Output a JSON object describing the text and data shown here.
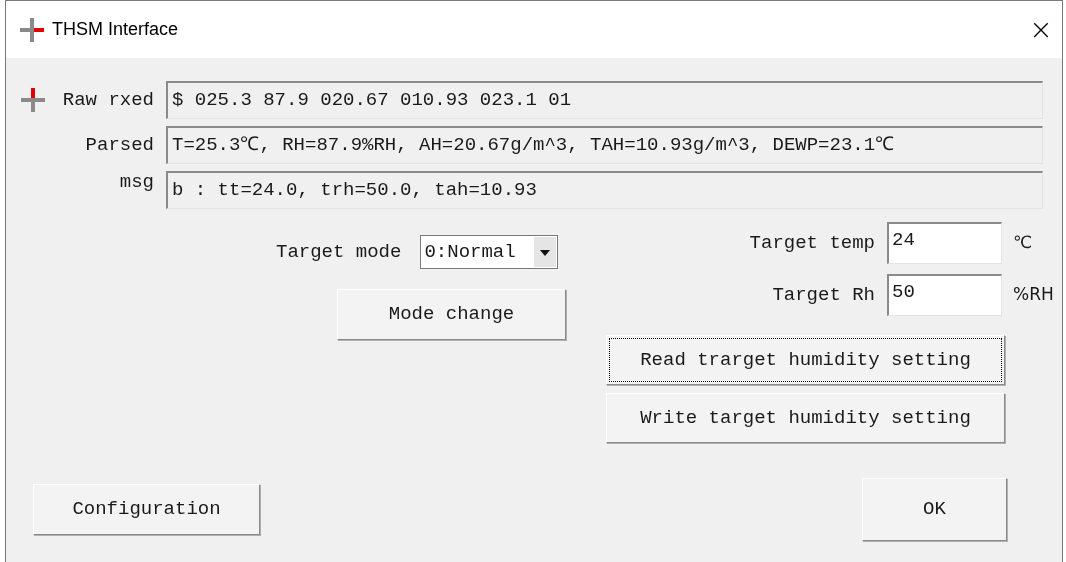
{
  "window": {
    "title": "THSM Interface",
    "close": "×"
  },
  "readouts": [
    {
      "label": "Raw rxed",
      "value": "$ 025.3 87.9 020.67 010.93 023.1 01"
    },
    {
      "label": "Parsed",
      "value": "T=25.3℃, RH=87.9%RH, AH=20.67g/m^3, TAH=10.93g/m^3, DEWP=23.1℃"
    },
    {
      "label": "msg",
      "value": "b : tt=24.0, trh=50.0, tah=10.93"
    }
  ],
  "target_mode": {
    "label": "Target mode",
    "value": "0:Normal"
  },
  "mode_change": {
    "label": "Mode change",
    "focused": false
  },
  "settings": [
    {
      "label": "Target temp",
      "value": "24",
      "unit": "℃"
    },
    {
      "label": "Target Rh",
      "value": "50",
      "unit": "%RH"
    }
  ],
  "actions": [
    {
      "label": "Read trarget humidity setting",
      "focused": true
    },
    {
      "label": "Write target humidity setting",
      "focused": false
    }
  ],
  "footer": [
    {
      "label": "Configuration",
      "focused": false
    },
    {
      "label": "OK",
      "focused": false
    }
  ]
}
